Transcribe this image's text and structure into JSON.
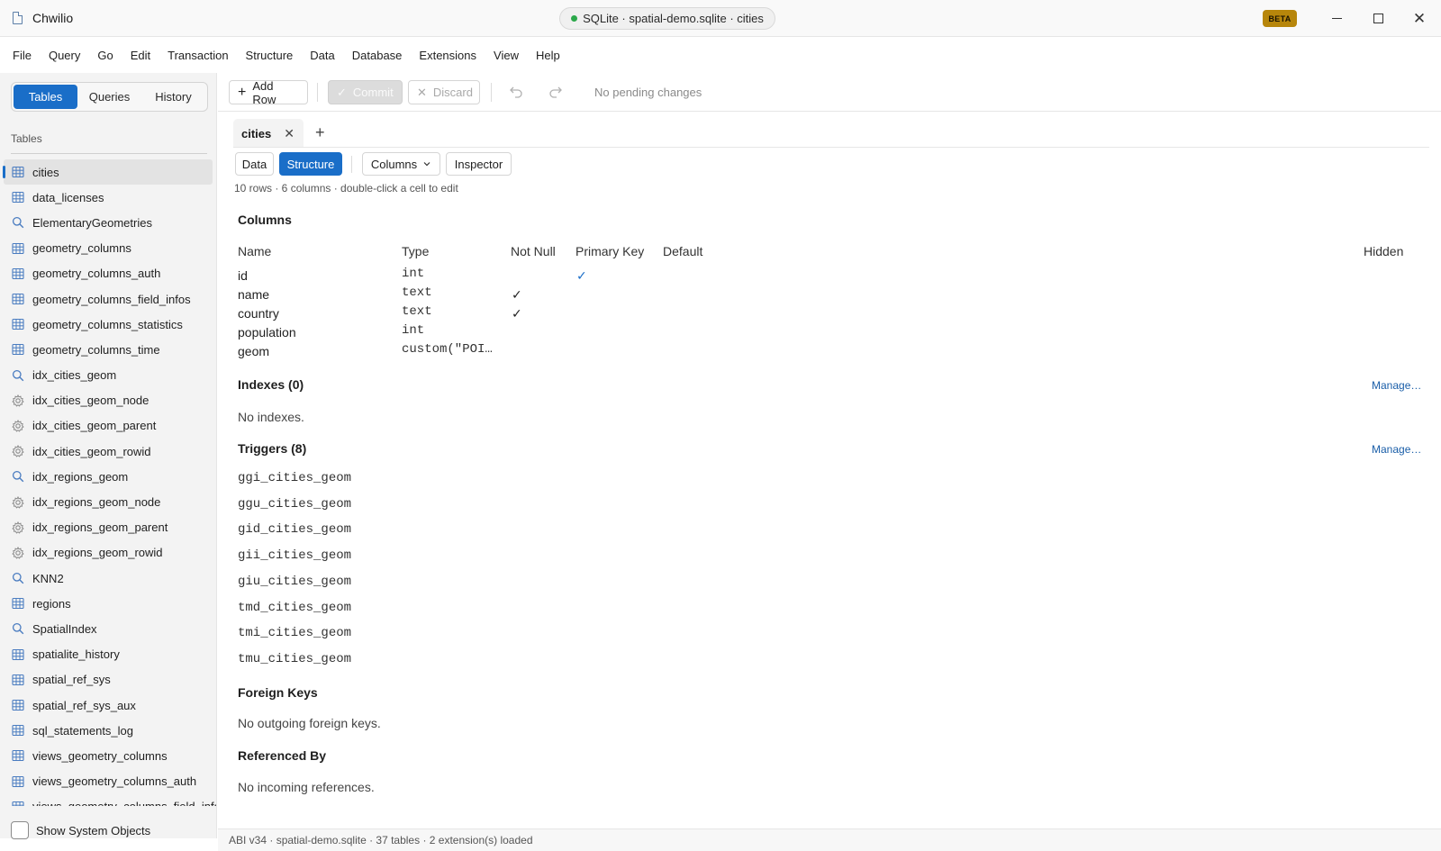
{
  "window": {
    "app_title": "Chwilio",
    "connection": "SQLite · spatial-demo.sqlite · cities",
    "badge": "BETA"
  },
  "menu": [
    "File",
    "Query",
    "Go",
    "Edit",
    "Transaction",
    "Structure",
    "Data",
    "Database",
    "Extensions",
    "View",
    "Help"
  ],
  "sidebar": {
    "tabs": [
      "Tables",
      "Queries",
      "History"
    ],
    "heading": "Tables",
    "items": [
      {
        "label": "cities",
        "icon": "table-icon"
      },
      {
        "label": "data_licenses",
        "icon": "table-icon"
      },
      {
        "label": "ElementaryGeometries",
        "icon": "search-icon"
      },
      {
        "label": "geometry_columns",
        "icon": "table-icon"
      },
      {
        "label": "geometry_columns_auth",
        "icon": "table-icon"
      },
      {
        "label": "geometry_columns_field_infos",
        "icon": "table-icon"
      },
      {
        "label": "geometry_columns_statistics",
        "icon": "table-icon"
      },
      {
        "label": "geometry_columns_time",
        "icon": "table-icon"
      },
      {
        "label": "idx_cities_geom",
        "icon": "search-icon"
      },
      {
        "label": "idx_cities_geom_node",
        "icon": "gear-icon"
      },
      {
        "label": "idx_cities_geom_parent",
        "icon": "gear-icon"
      },
      {
        "label": "idx_cities_geom_rowid",
        "icon": "gear-icon"
      },
      {
        "label": "idx_regions_geom",
        "icon": "search-icon"
      },
      {
        "label": "idx_regions_geom_node",
        "icon": "gear-icon"
      },
      {
        "label": "idx_regions_geom_parent",
        "icon": "gear-icon"
      },
      {
        "label": "idx_regions_geom_rowid",
        "icon": "gear-icon"
      },
      {
        "label": "KNN2",
        "icon": "search-icon"
      },
      {
        "label": "regions",
        "icon": "table-icon"
      },
      {
        "label": "SpatialIndex",
        "icon": "search-icon"
      },
      {
        "label": "spatialite_history",
        "icon": "table-icon"
      },
      {
        "label": "spatial_ref_sys",
        "icon": "table-icon"
      },
      {
        "label": "spatial_ref_sys_aux",
        "icon": "table-icon"
      },
      {
        "label": "sql_statements_log",
        "icon": "table-icon"
      },
      {
        "label": "views_geometry_columns",
        "icon": "table-icon"
      },
      {
        "label": "views_geometry_columns_auth",
        "icon": "table-icon"
      },
      {
        "label": "views_geometry_columns_field_info",
        "icon": "table-icon"
      }
    ],
    "show_system": "Show System Objects"
  },
  "toolbar": {
    "add_row": "Add Row",
    "commit": "Commit",
    "discard": "Discard",
    "pending": "No pending changes"
  },
  "tab": {
    "label": "cities",
    "views": [
      "Data",
      "Structure"
    ],
    "columns_dropdown": "Columns",
    "inspector": "Inspector",
    "meta": "10 rows  ·  6 columns  ·  double-click a cell to edit"
  },
  "columns_section": {
    "title": "Columns",
    "headers": {
      "name": "Name",
      "type": "Type",
      "not_null": "Not Null",
      "primary_key": "Primary Key",
      "default": "Default",
      "hidden": "Hidden"
    },
    "rows": [
      {
        "name": "id",
        "type": "int",
        "not_null": false,
        "primary_key": true
      },
      {
        "name": "name",
        "type": "text",
        "not_null": true,
        "primary_key": false
      },
      {
        "name": "country",
        "type": "text",
        "not_null": true,
        "primary_key": false
      },
      {
        "name": "population",
        "type": "int",
        "not_null": false,
        "primary_key": false
      },
      {
        "name": "geom",
        "type": "custom(\"POI…",
        "not_null": false,
        "primary_key": false
      }
    ],
    "check_glyph": "✓"
  },
  "indexes": {
    "title": "Indexes (0)",
    "manage": "Manage…",
    "empty": "No indexes."
  },
  "triggers": {
    "title": "Triggers (8)",
    "manage": "Manage…",
    "items": [
      "ggi_cities_geom",
      "ggu_cities_geom",
      "gid_cities_geom",
      "gii_cities_geom",
      "giu_cities_geom",
      "tmd_cities_geom",
      "tmi_cities_geom",
      "tmu_cities_geom"
    ]
  },
  "foreign_keys": {
    "title": "Foreign Keys",
    "empty": "No outgoing foreign keys."
  },
  "referenced_by": {
    "title": "Referenced By",
    "empty": "No incoming references."
  },
  "statusbar": "ABI v34  ·  spatial-demo.sqlite  ·  37 tables  ·  2 extension(s) loaded",
  "colors": {
    "accent": "#1a6ec8",
    "badge": "#b7860b",
    "connected": "#2ba84a"
  }
}
